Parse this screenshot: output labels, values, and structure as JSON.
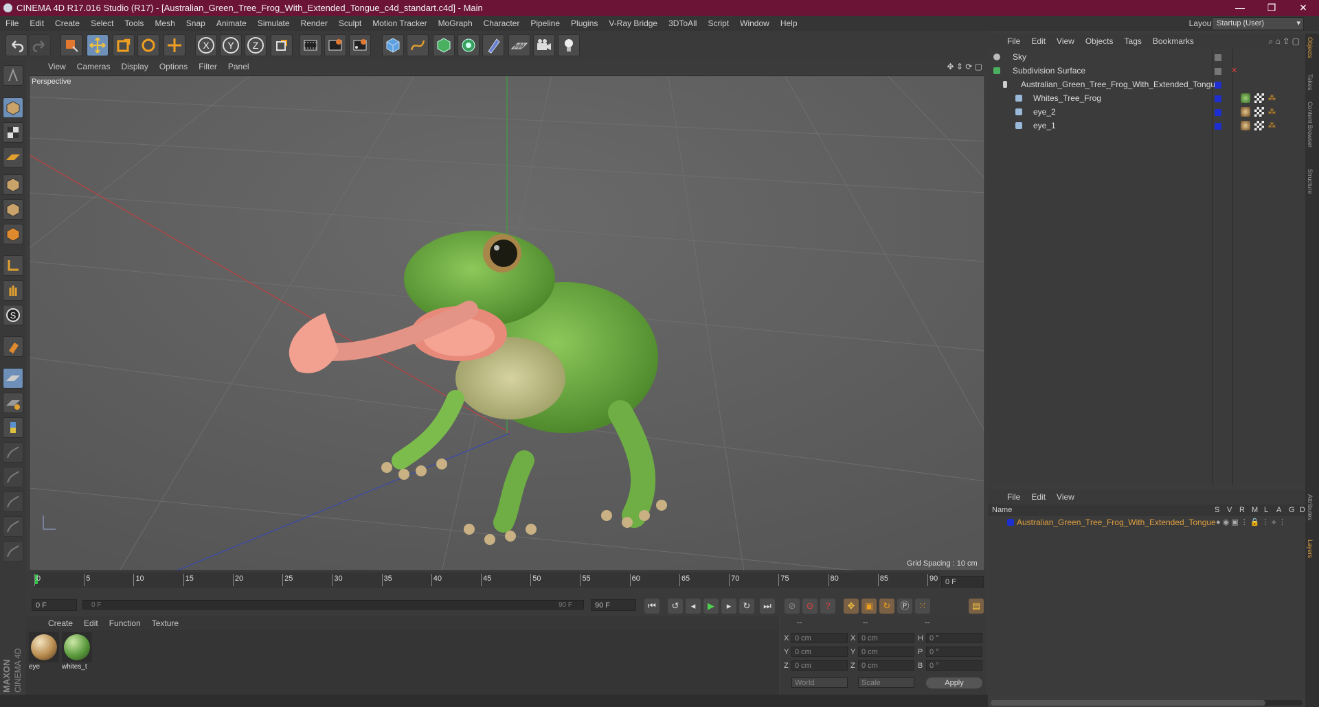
{
  "window": {
    "title": "CINEMA 4D R17.016 Studio (R17) - [Australian_Green_Tree_Frog_With_Extended_Tongue_c4d_standart.c4d] - Main",
    "controls": [
      "—",
      "❐",
      "✕"
    ]
  },
  "menubar": {
    "items": [
      "File",
      "Edit",
      "Create",
      "Select",
      "Tools",
      "Mesh",
      "Snap",
      "Animate",
      "Simulate",
      "Render",
      "Sculpt",
      "Motion Tracker",
      "MoGraph",
      "Character",
      "Pipeline",
      "Plugins",
      "V-Ray Bridge",
      "3DToAll",
      "Script",
      "Window",
      "Help"
    ],
    "layout_label": "Layout:",
    "layout_value": "Startup (User)"
  },
  "toolbar": {
    "icons": [
      "undo-icon",
      "redo-icon",
      "live-selection-icon",
      "move-icon",
      "scale-icon",
      "rotate-icon",
      "last-tool-icon",
      "x-axis-icon",
      "y-axis-icon",
      "z-axis-icon",
      "world-coordinates-icon",
      "render-view-icon",
      "render-region-icon",
      "render-settings-icon",
      "cube-icon",
      "pen-spline-icon",
      "subdivision-icon",
      "array-icon",
      "deformer-icon",
      "floor-icon",
      "camera-icon",
      "light-icon"
    ],
    "axis_labels": [
      "X",
      "Y",
      "Z"
    ]
  },
  "viewport": {
    "menu": [
      "View",
      "Cameras",
      "Display",
      "Options",
      "Filter",
      "Panel"
    ],
    "label": "Perspective",
    "grid_spacing": "Grid Spacing : 10 cm"
  },
  "timeline": {
    "ticks": [
      "0",
      "5",
      "10",
      "15",
      "20",
      "25",
      "30",
      "35",
      "40",
      "45",
      "50",
      "55",
      "60",
      "65",
      "70",
      "75",
      "80",
      "85",
      "90"
    ],
    "current_frame": "0 F",
    "start_field": "0 F",
    "range_start": "0 F",
    "range_end": "90 F",
    "end_field": "90 F"
  },
  "materials": {
    "menu": [
      "Create",
      "Edit",
      "Function",
      "Texture"
    ],
    "items": [
      {
        "label": "eye",
        "color": "#b98c4e"
      },
      {
        "label": "whites_t",
        "color": "#5a9a3c"
      }
    ]
  },
  "coordinates": {
    "headers": [
      "--",
      "--",
      "--"
    ],
    "rows": [
      {
        "a": "X",
        "av": "0 cm",
        "b": "X",
        "bv": "0 cm",
        "c": "H",
        "cv": "0 °"
      },
      {
        "a": "Y",
        "av": "0 cm",
        "b": "Y",
        "bv": "0 cm",
        "c": "P",
        "cv": "0 °"
      },
      {
        "a": "Z",
        "av": "0 cm",
        "b": "Z",
        "bv": "0 cm",
        "c": "B",
        "cv": "0 °"
      }
    ],
    "mode1": "World",
    "mode2": "Scale",
    "apply": "Apply"
  },
  "object_manager": {
    "menu": [
      "File",
      "Edit",
      "View",
      "Objects",
      "Tags",
      "Bookmarks"
    ],
    "objects": [
      {
        "name": "Sky",
        "indent": 0
      },
      {
        "name": "Subdivision Surface",
        "indent": 0
      },
      {
        "name": "Australian_Green_Tree_Frog_With_Extended_Tongue",
        "indent": 1
      },
      {
        "name": "Whites_Tree_Frog",
        "indent": 2
      },
      {
        "name": "eye_2",
        "indent": 2
      },
      {
        "name": "eye_1",
        "indent": 2
      }
    ]
  },
  "layer_manager": {
    "menu": [
      "File",
      "Edit",
      "View"
    ],
    "columns": [
      "Name",
      "S",
      "V",
      "R",
      "M",
      "L",
      "A",
      "G",
      "D"
    ],
    "layers": [
      {
        "name": "Australian_Green_Tree_Frog_With_Extended_Tongue",
        "color": "#1d2fd0"
      }
    ]
  },
  "right_tabs": [
    "Objects",
    "Takes",
    "Content Browser",
    "Structure"
  ],
  "right_tabs_lower": [
    "Attributes",
    "Layers"
  ],
  "brand": {
    "maxon": "MAXON",
    "product": "CINEMA 4D"
  },
  "colors": {
    "title_bar": "#6c1436",
    "accent": "#6d8fb8",
    "layer_name": "#e0a040"
  }
}
